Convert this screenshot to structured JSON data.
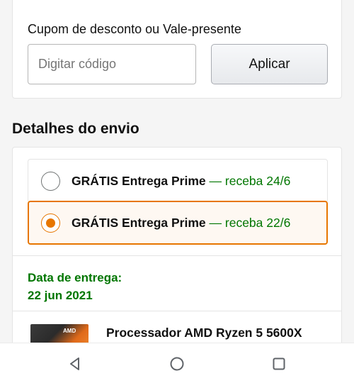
{
  "coupon": {
    "label": "Cupom de desconto ou Vale-presente",
    "input_value": "",
    "input_placeholder": "Digitar código",
    "apply_label": "Aplicar"
  },
  "shipping": {
    "title": "Detalhes do envio",
    "options": [
      {
        "label": "GRÁTIS Entrega Prime",
        "separator": "— receba",
        "date": "24/6",
        "selected": false
      },
      {
        "label": "GRÁTIS Entrega Prime",
        "separator": "— receba",
        "date": "22/6",
        "selected": true
      }
    ],
    "delivery_label": "Data de entrega:",
    "delivery_date": "22 jun 2021",
    "product": {
      "thumbnail_brand": "AMD",
      "title": "Processador AMD Ryzen 5 5600X"
    }
  },
  "navbar": {
    "icons": [
      "back-icon",
      "home-icon",
      "recent-apps-icon"
    ]
  },
  "colors": {
    "accent_orange": "#e77600",
    "delivery_green": "#007600",
    "selected_bg": "#fef8f2"
  }
}
